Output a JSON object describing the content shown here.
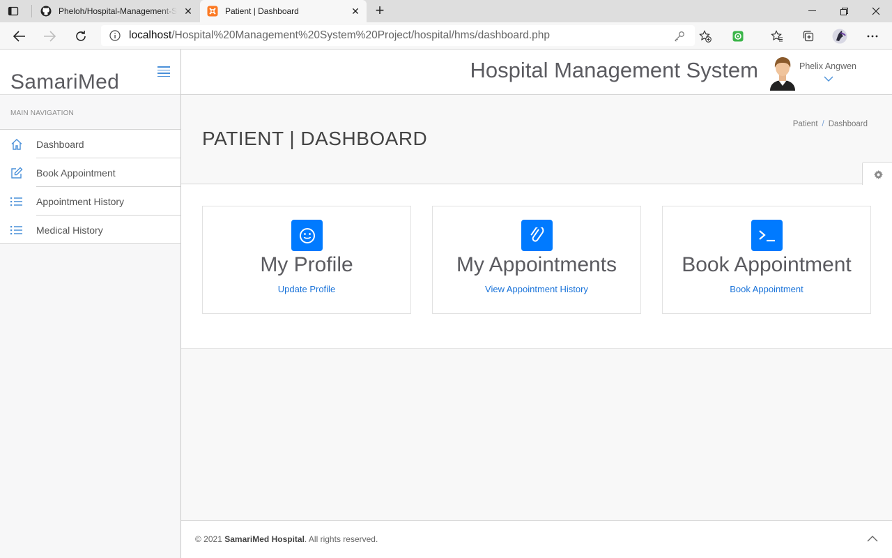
{
  "browser": {
    "tabs": [
      {
        "title": "Pheloh/Hospital-Management-System",
        "icon": "github-icon"
      },
      {
        "title": "Patient | Dashboard",
        "icon": "xampp-icon",
        "active": true
      }
    ],
    "url_host": "localhost",
    "url_path": "/Hospital%20Management%20System%20Project/hospital/hms/dashboard.php"
  },
  "sidebar": {
    "brand": "SamariMed",
    "nav_label": "MAIN NAVIGATION",
    "items": [
      {
        "label": "Dashboard",
        "icon": "home-icon"
      },
      {
        "label": "Book Appointment",
        "icon": "edit-icon"
      },
      {
        "label": "Appointment History",
        "icon": "list-icon"
      },
      {
        "label": "Medical History",
        "icon": "list-icon"
      }
    ]
  },
  "header": {
    "title": "Hospital Management System",
    "user_name": "Phelix Angwen"
  },
  "page": {
    "title": "PATIENT | DASHBOARD",
    "breadcrumb": [
      "Patient",
      "Dashboard"
    ]
  },
  "cards": [
    {
      "title": "My Profile",
      "link": "Update Profile",
      "icon": "smile-icon"
    },
    {
      "title": "My Appointments",
      "link": "View Appointment History",
      "icon": "paperclip-icon"
    },
    {
      "title": "Book Appointment",
      "link": "Book Appointment",
      "icon": "terminal-icon"
    }
  ],
  "footer": {
    "year": "© 2021",
    "org": "SamariMed Hospital",
    "rights": ". All rights reserved."
  },
  "colors": {
    "accent": "#007aff",
    "link": "#1a73d9"
  }
}
